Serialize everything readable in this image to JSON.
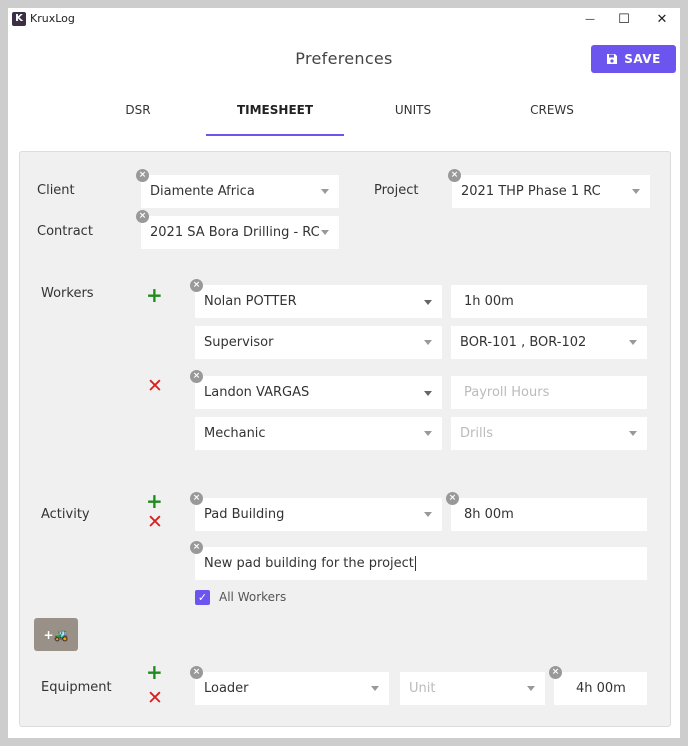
{
  "app": {
    "title": "KruxLog",
    "logo_letter": "K"
  },
  "window_controls": {
    "minimize": "—",
    "maximize": "☐",
    "close": "✕"
  },
  "header": {
    "title": "Preferences",
    "save_label": "SAVE"
  },
  "tabs": [
    {
      "label": "DSR",
      "active": false
    },
    {
      "label": "TIMESHEET",
      "active": true
    },
    {
      "label": "UNITS",
      "active": false
    },
    {
      "label": "CREWS",
      "active": false
    }
  ],
  "form": {
    "client": {
      "label": "Client",
      "value": "Diamente Africa"
    },
    "project": {
      "label": "Project",
      "value": "2021 THP Phase 1 RC"
    },
    "contract": {
      "label": "Contract",
      "value": "2021 SA Bora Drilling - RC"
    },
    "workers": {
      "label": "Workers",
      "entries": [
        {
          "name": "Nolan POTTER",
          "hours": "1h 00m",
          "role": "Supervisor",
          "assets": "BOR-101 , BOR-102"
        },
        {
          "name": "Landon VARGAS",
          "hours_placeholder": "Payroll Hours",
          "role": "Mechanic",
          "assets_placeholder": "Drills"
        }
      ]
    },
    "activity": {
      "label": "Activity",
      "type": "Pad Building",
      "hours": "8h 00m",
      "description": "New pad building for the project",
      "all_workers_label": "All Workers",
      "all_workers_checked": true
    },
    "add_equipment_button": "+🚜",
    "equipment": {
      "label": "Equipment",
      "type": "Loader",
      "unit_placeholder": "Unit",
      "hours": "4h 00m"
    }
  },
  "colors": {
    "accent": "#6c54ef",
    "add": "#1d8c1d",
    "remove": "#d92020"
  }
}
